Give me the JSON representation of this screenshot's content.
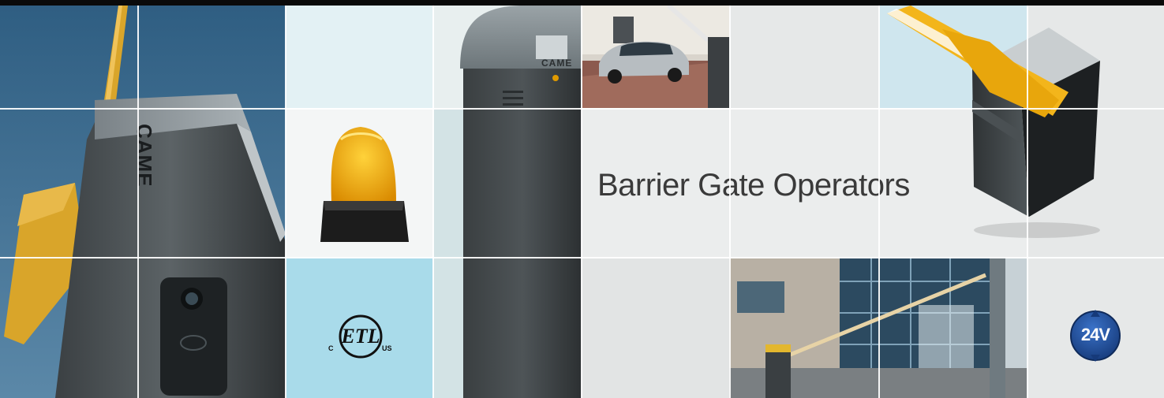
{
  "banner": {
    "headline": "Barrier Gate Operators",
    "brand_mark": "CAME",
    "certification": {
      "mark": "ETL",
      "left_letter": "C",
      "right_letters": "US"
    },
    "voltage_badge": "24V"
  },
  "colors": {
    "sky_blue": "#3f6f8f",
    "housing_grey": "#4a4f52",
    "amber": "#f2b318",
    "light_panel": "#e9ecec",
    "pale_blue": "#a9dbea",
    "badge_blue": "#1f4fa0",
    "arm_yellow": "#d9a52a"
  }
}
